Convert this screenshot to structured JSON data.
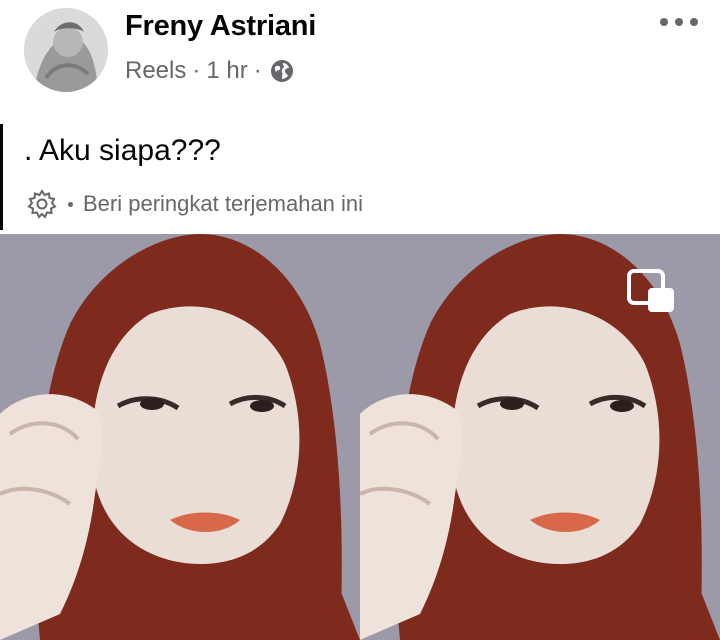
{
  "post_header": {
    "author_name": "Freny Astriani",
    "source": "Reels",
    "separator": "·",
    "time": "1 hr",
    "audience_icon": "globe-icon",
    "menu_icon": "more-options-icon"
  },
  "post_body": {
    "text": ". Aku siapa???",
    "translation_rating_text": "Beri peringkat terjemahan ini",
    "settings_icon": "gear-icon"
  },
  "media": {
    "icon": "picture-in-picture-icon"
  },
  "colors": {
    "text_primary": "#050505",
    "text_secondary": "#65676b",
    "hijab": "#8a2a1c",
    "background_wall": "#9a97a6"
  }
}
